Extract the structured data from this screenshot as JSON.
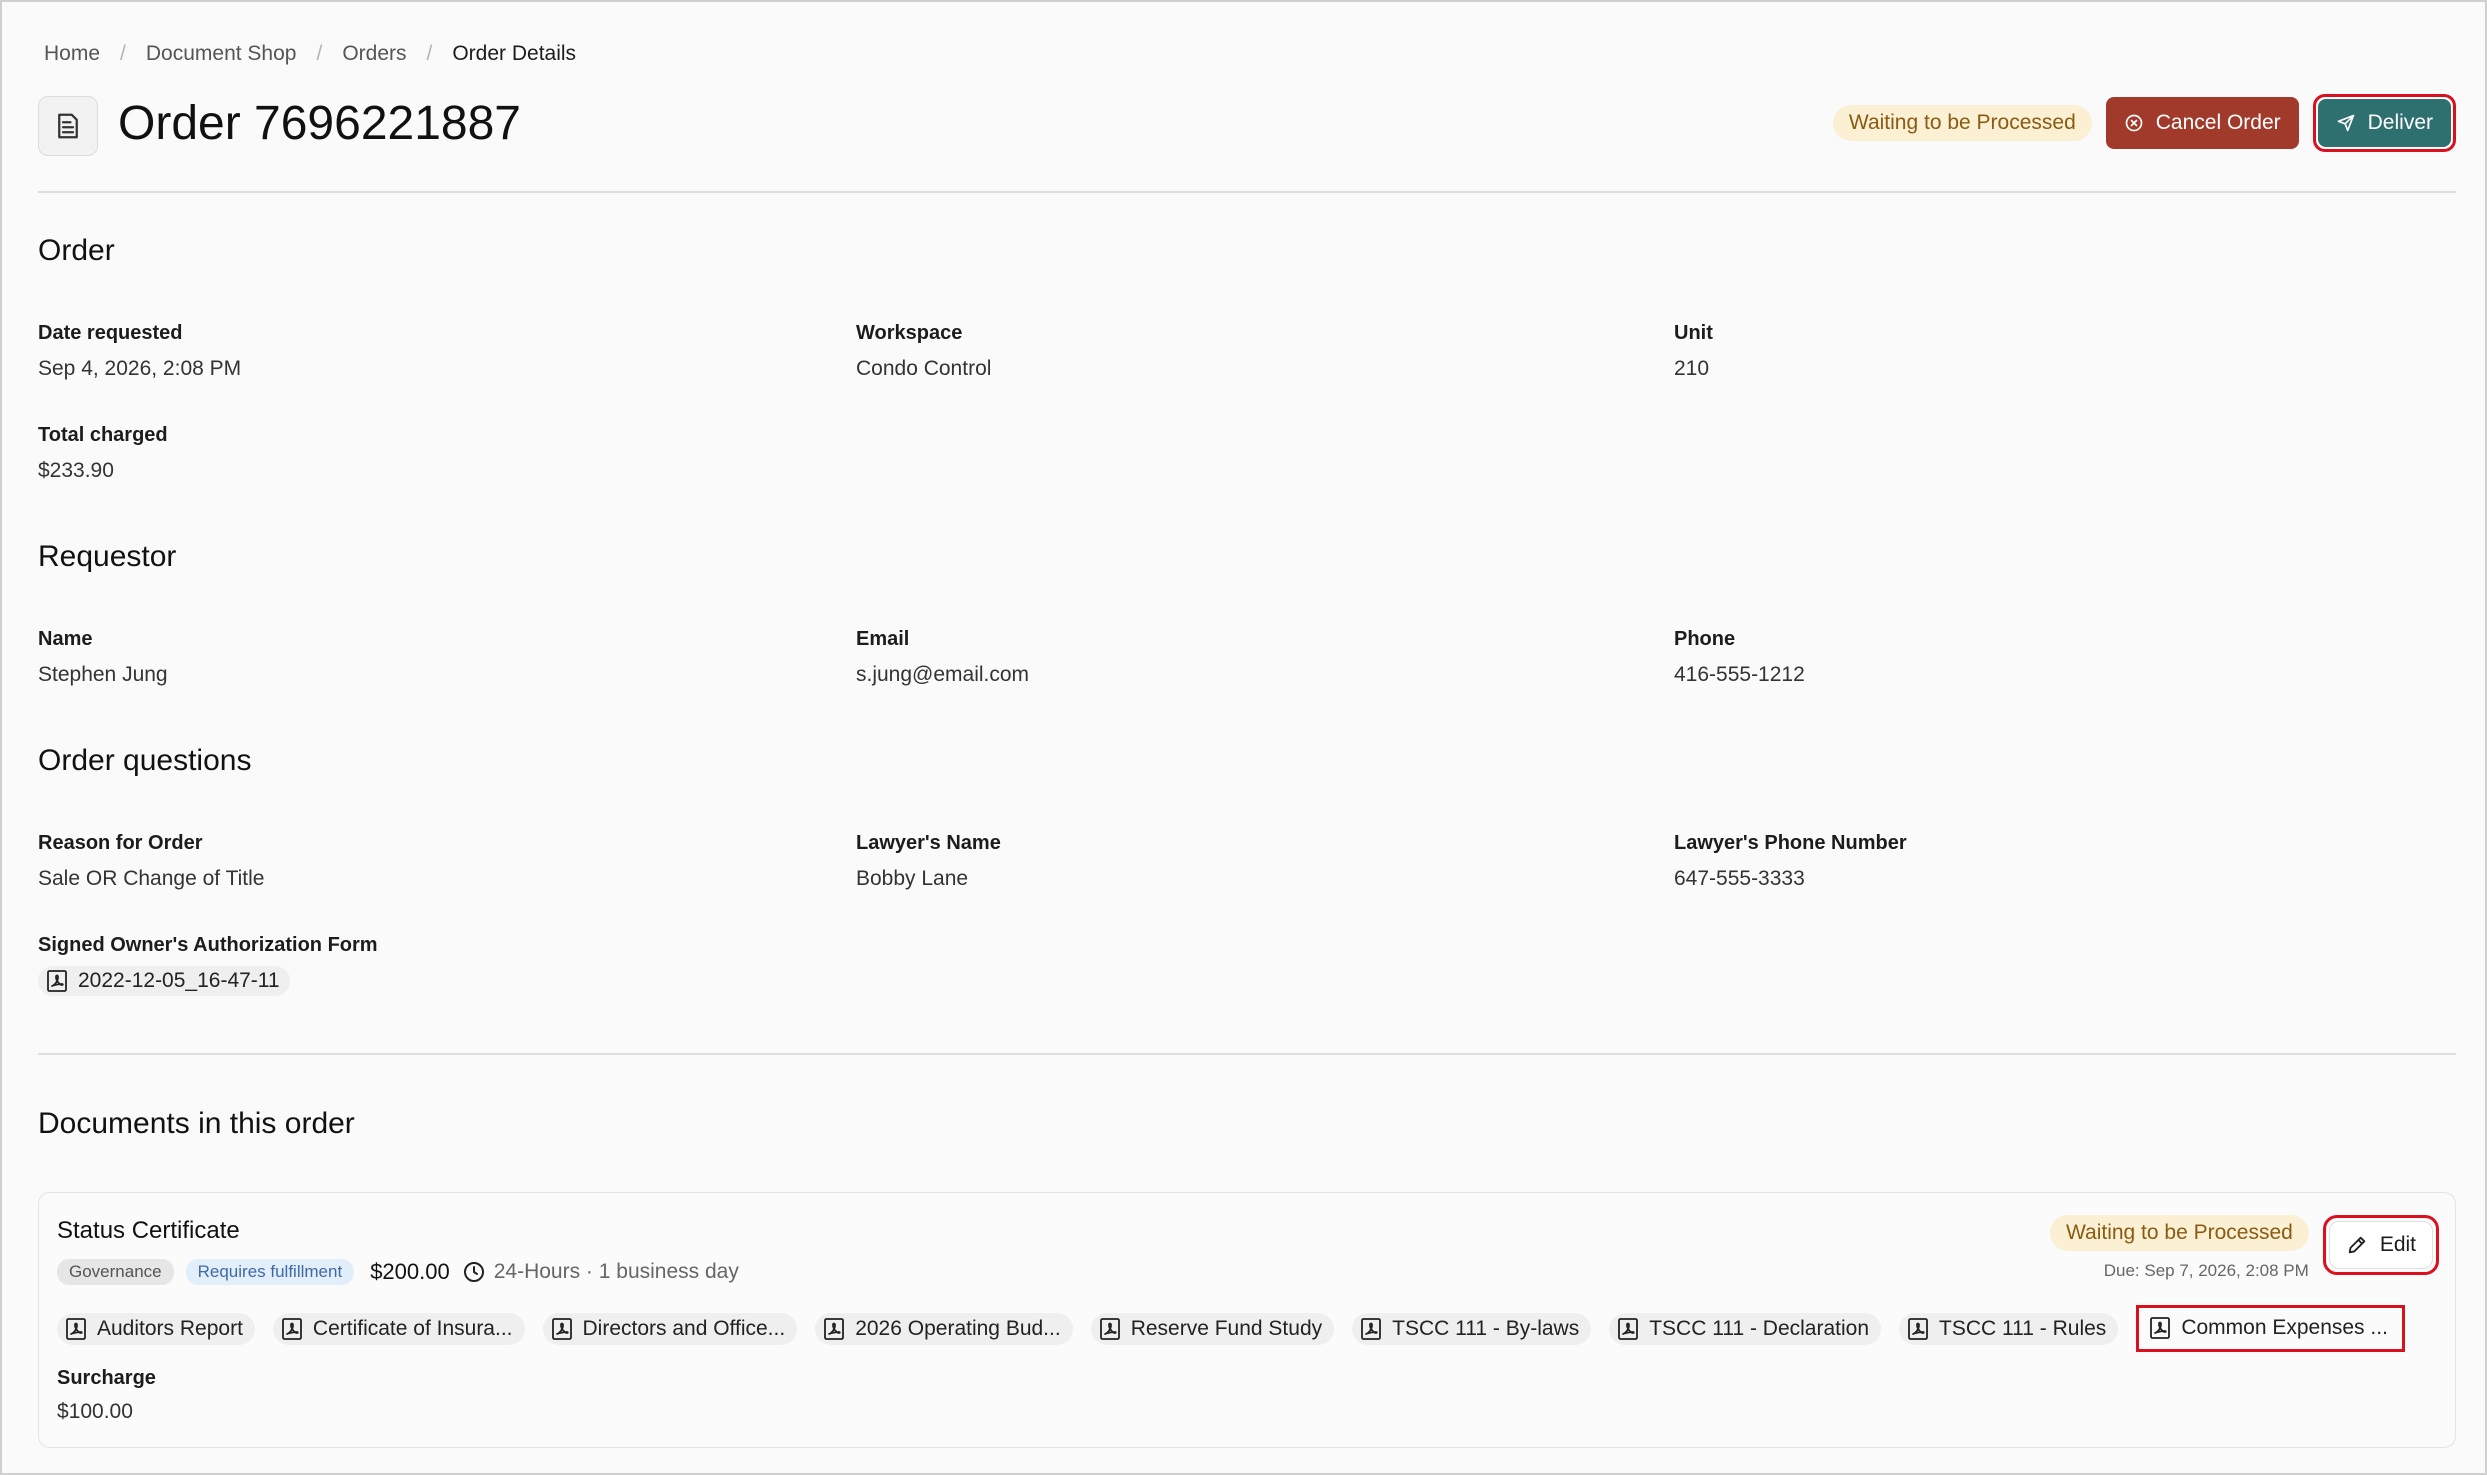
{
  "breadcrumb": [
    "Home",
    "Document Shop",
    "Orders",
    "Order Details"
  ],
  "header": {
    "title": "Order 7696221887",
    "status": "Waiting to be Processed",
    "cancel_label": "Cancel Order",
    "deliver_label": "Deliver"
  },
  "order": {
    "section_title": "Order",
    "date_requested_label": "Date requested",
    "date_requested": "Sep 4, 2026, 2:08 PM",
    "workspace_label": "Workspace",
    "workspace": "Condo Control",
    "unit_label": "Unit",
    "unit": "210",
    "total_charged_label": "Total charged",
    "total_charged": "$233.90"
  },
  "requestor": {
    "section_title": "Requestor",
    "name_label": "Name",
    "name": "Stephen Jung",
    "email_label": "Email",
    "email": "s.jung@email.com",
    "phone_label": "Phone",
    "phone": "416-555-1212"
  },
  "questions": {
    "section_title": "Order questions",
    "reason_label": "Reason for Order",
    "reason": "Sale OR Change of Title",
    "lawyer_name_label": "Lawyer's Name",
    "lawyer_name": "Bobby Lane",
    "lawyer_phone_label": "Lawyer's Phone Number",
    "lawyer_phone": "647-555-3333",
    "auth_form_label": "Signed Owner's Authorization Form",
    "auth_form_file": "2022-12-05_16-47-11"
  },
  "documents": {
    "section_title": "Documents in this order",
    "item": {
      "name": "Status Certificate",
      "tag_category": "Governance",
      "tag_fulfillment": "Requires fulfillment",
      "price": "$200.00",
      "turnaround": "24-Hours · 1 business day",
      "status": "Waiting to be Processed",
      "due": "Due: Sep 7, 2026, 2:08 PM",
      "edit_label": "Edit",
      "files": [
        "Auditors Report",
        "Certificate of Insura...",
        "Directors and Office...",
        "2026 Operating Bud...",
        "Reserve Fund Study",
        "TSCC 111 - By-laws",
        "TSCC 111 - Declaration",
        "TSCC 111 - Rules",
        "Common Expenses ..."
      ],
      "surcharge_label": "Surcharge",
      "surcharge": "$100.00"
    }
  },
  "colors": {
    "cancel": "#a23a2b",
    "deliver": "#2e6f70",
    "status_bg": "#fbefd4",
    "highlight": "#d9101e"
  }
}
